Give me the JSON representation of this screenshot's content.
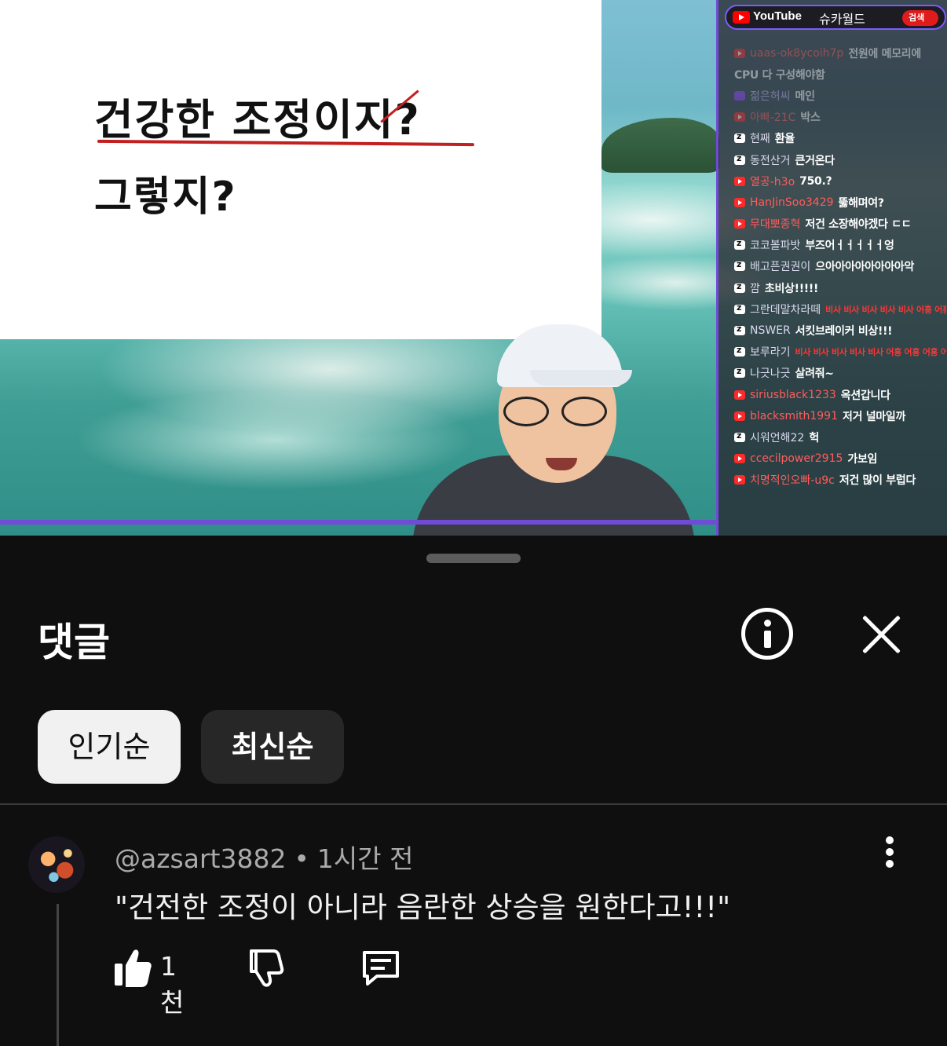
{
  "video": {
    "slide": {
      "line1": "건강한 조정이지?",
      "line2": "그렇지?"
    },
    "chat": {
      "platform_label": "YouTube",
      "channel": "슈카월드",
      "search_label": "검색",
      "messages": [
        {
          "icon": "youtube",
          "name": "uaas-ok8ycoih7p",
          "text": "전원에 메모리에",
          "faded": true
        },
        {
          "icon": "none",
          "name": "",
          "text": "CPU 다 구성해야함",
          "faded": true
        },
        {
          "icon": "twitch",
          "name": "젊은허씨",
          "text": "메인",
          "faded": true
        },
        {
          "icon": "youtube",
          "name": "아빠-21C",
          "text": "박스",
          "faded": true
        },
        {
          "icon": "chzzk",
          "name": "현째",
          "text": "환율"
        },
        {
          "icon": "chzzk",
          "name": "동전산거",
          "text": "큰거온다"
        },
        {
          "icon": "youtube",
          "name": "열공-h3o",
          "text": "750.?"
        },
        {
          "icon": "youtube",
          "name": "HanJinSoo3429",
          "text": "뚫해며여?"
        },
        {
          "icon": "youtube",
          "name": "무대뽀종혁",
          "text": "저건 소장해야겠다 ㄷㄷ"
        },
        {
          "icon": "chzzk",
          "name": "코코볼파밧",
          "text": "부즈어ㅓㅓㅓㅓㅓ엉"
        },
        {
          "icon": "chzzk",
          "name": "배고픈권권이",
          "text": "으아아아아아아아아악"
        },
        {
          "icon": "chzzk",
          "name": "깜",
          "text": "초비상!!!!!"
        },
        {
          "icon": "chzzk",
          "name": "그란데말차라떼",
          "text": "비사 비사 비사 비사 비사 어흥 어흥 어흥 어흥 어흥",
          "red": true
        },
        {
          "icon": "chzzk",
          "name": "NSWER",
          "text": "서킷브레이커 비상!!!"
        },
        {
          "icon": "chzzk",
          "name": "보루라기",
          "text": "비사 비사 비사 비사 비사 어흥 어흥 어흥 어흥 어흥",
          "red": true
        },
        {
          "icon": "chzzk",
          "name": "나긋나긋",
          "text": "살려줘~"
        },
        {
          "icon": "youtube",
          "name": "siriusblack1233",
          "text": "옥션갑니다"
        },
        {
          "icon": "youtube",
          "name": "blacksmith1991",
          "text": "저거 널마일까"
        },
        {
          "icon": "chzzk",
          "name": "시워언해22",
          "text": "헉"
        },
        {
          "icon": "youtube",
          "name": "ccecilpower2915",
          "text": "가보임"
        },
        {
          "icon": "youtube",
          "name": "치명적인오빠-u9c",
          "text": "저건 많이 부럽다"
        }
      ]
    }
  },
  "sheet": {
    "title": "댓글",
    "chips": {
      "popular": "인기순",
      "newest": "최신순"
    },
    "comment": {
      "author": "@azsart3882",
      "separator": "•",
      "time": "1시간 전",
      "text": "\"건전한 조정이 아니라 음란한 상승을 원한다고!!!\"",
      "like_count": "1천"
    }
  },
  "colors": {
    "background": "#0f0f0f",
    "chip_active_bg": "#f1f1f1",
    "chip_inactive_bg": "#272727",
    "chat_border": "#6f4bd6"
  }
}
